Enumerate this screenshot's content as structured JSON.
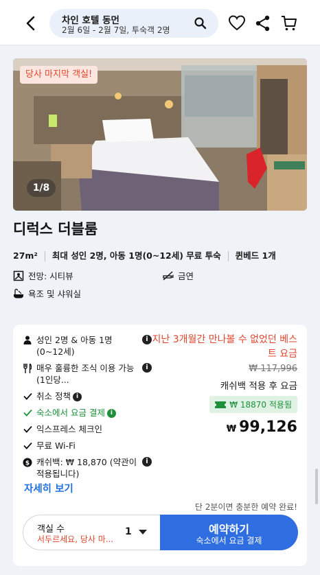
{
  "header": {
    "title": "차인 호텔 동먼",
    "subtitle": "2월 6일 - 2월 7일, 투숙객 2명"
  },
  "hero": {
    "badge": "당사 마지막 객실!",
    "photo_counter": "1/8"
  },
  "room": {
    "name": "디럭스 더블룸",
    "size": "27m²",
    "occupancy": "최대 성인 2명, 아동 1명(0~12세) 무료 투숙",
    "bed": "퀸베드 1개",
    "features": {
      "view": "전망: 시티뷰",
      "smoking": "금연",
      "bath": "욕조 및 샤워실"
    }
  },
  "offer": {
    "inclusions": {
      "guests": "성인 2명 & 아동 1명 (0~12세)",
      "breakfast": "매우 훌륭한 조식 이용 가능 (1인당...",
      "cancellation": "취소 정책",
      "pay_at_property": "숙소에서 요금 결제",
      "express_checkin": "익스프레스 체크인",
      "wifi": "무료 Wi-Fi",
      "cashback": "캐쉬백: ₩ 18,870 (약관이 적용됩니다)"
    },
    "details_link": "자세히 보기",
    "best_rate": "지난 3개월간 만나볼 수 없었던 베스트 요금",
    "original_price": "₩ 117,996",
    "cashback_note": "캐쉬백 적용 후 요금",
    "cashback_applied": "₩ 18870 적용됨",
    "currency": "₩",
    "final_price": "99,126",
    "urgency": "단 2분이면 충분한 예약 완료!",
    "booking": {
      "rooms_label": "객실 수",
      "rooms_hint": "서두르세요, 당사 마...",
      "rooms_count": "1",
      "book_label": "예약하기",
      "book_sub": "숙소에서 요금 결제"
    }
  },
  "colors": {
    "accent_blue": "#2f6ee0",
    "alert_red": "#e2452d",
    "success_green": "#1e8f3a"
  },
  "icons": [
    "back-arrow-icon",
    "search-icon",
    "heart-icon",
    "share-icon",
    "cart-icon",
    "view-icon",
    "no-smoking-icon",
    "bath-icon",
    "person-icon",
    "utensils-icon",
    "check-icon",
    "cashback-icon",
    "info-icon",
    "cashback-ticket-icon"
  ]
}
